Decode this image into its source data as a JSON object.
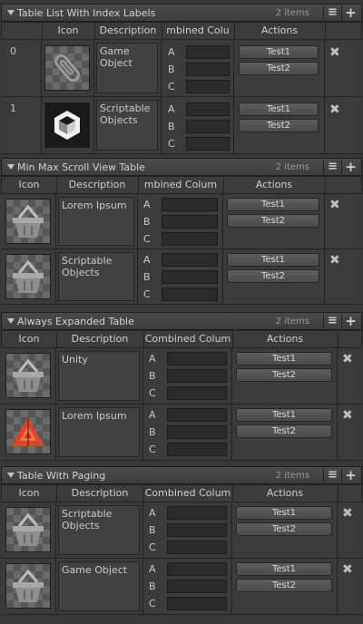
{
  "sections": [
    {
      "title": "Table List With Index Labels",
      "count": "2 items",
      "columns": [
        "",
        "Icon",
        "Description",
        "mbined Colu",
        "Actions"
      ],
      "rows": [
        {
          "index": "0",
          "icon": "paperclip-icon",
          "description": "Game Object",
          "letters": [
            "A",
            "B",
            "C"
          ],
          "buttons": [
            "Test1",
            "Test2"
          ]
        },
        {
          "index": "1",
          "icon": "unity-logo-icon",
          "description": "Scriptable Objects",
          "letters": [
            "A",
            "B",
            "C"
          ],
          "buttons": [
            "Test1",
            "Test2"
          ]
        }
      ]
    },
    {
      "title": "Min Max Scroll View Table",
      "count": "2 items",
      "columns": [
        "Icon",
        "Description",
        "mbined Colum",
        "Actions"
      ],
      "rows": [
        {
          "icon": "basket-icon",
          "description": "Lorem Ipsum",
          "letters": [
            "A",
            "B",
            "C"
          ],
          "buttons": [
            "Test1",
            "Test2"
          ]
        },
        {
          "icon": "basket-icon",
          "description": "Scriptable Objects",
          "letters": [
            "A",
            "B",
            "C"
          ],
          "buttons": [
            "Test1",
            "Test2"
          ]
        }
      ]
    },
    {
      "title": "Always Expanded Table",
      "count": "2 items",
      "columns": [
        "Icon",
        "Description",
        "Combined Colum",
        "Actions"
      ],
      "rows": [
        {
          "icon": "basket-icon",
          "description": "Unity",
          "letters": [
            "A",
            "B",
            "C"
          ],
          "buttons": [
            "Test1",
            "Test2"
          ]
        },
        {
          "icon": "red-triangle-logo-icon",
          "description": "Lorem Ipsum",
          "letters": [
            "A",
            "B",
            "C"
          ],
          "buttons": [
            "Test1",
            "Test2"
          ]
        }
      ]
    },
    {
      "title": "Table With Paging",
      "count": "2 items",
      "columns": [
        "Icon",
        "Description",
        "Combined Colum",
        "Actions"
      ],
      "rows": [
        {
          "icon": "basket-icon",
          "description": "Scriptable Objects",
          "letters": [
            "A",
            "B",
            "C"
          ],
          "buttons": [
            "Test1",
            "Test2"
          ]
        },
        {
          "icon": "basket-icon",
          "description": "Game Object",
          "letters": [
            "A",
            "B",
            "C"
          ],
          "buttons": [
            "Test1",
            "Test2"
          ]
        }
      ]
    }
  ],
  "remove_glyph": "✖",
  "menu_glyph": "≡",
  "add_glyph": "+"
}
